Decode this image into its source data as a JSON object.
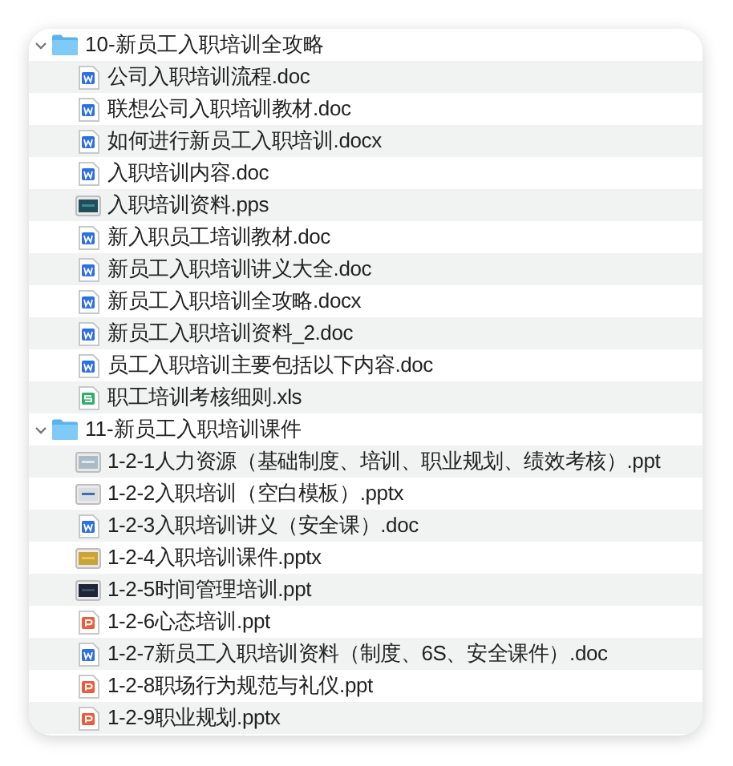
{
  "folders": [
    {
      "name": "10-新员工入职培训全攻略",
      "expanded": true,
      "files": [
        {
          "name": "公司入职培训流程.doc",
          "kind": "word"
        },
        {
          "name": "联想公司入职培训教材.doc",
          "kind": "word"
        },
        {
          "name": "如何进行新员工入职培训.docx",
          "kind": "word"
        },
        {
          "name": "入职培训内容.doc",
          "kind": "word"
        },
        {
          "name": "入职培训资料.pps",
          "kind": "preview-teal"
        },
        {
          "name": "新入职员工培训教材.doc",
          "kind": "word"
        },
        {
          "name": "新员工入职培训讲义大全.doc",
          "kind": "word"
        },
        {
          "name": "新员工入职培训全攻略.docx",
          "kind": "word"
        },
        {
          "name": "新员工入职培训资料_2.doc",
          "kind": "word"
        },
        {
          "name": "员工入职培训主要包括以下内容.doc",
          "kind": "word"
        },
        {
          "name": "职工培训考核细则.xls",
          "kind": "sheet"
        }
      ]
    },
    {
      "name": "11-新员工入职培训课件",
      "expanded": true,
      "files": [
        {
          "name": "1-2-1人力资源（基础制度、培训、职业规划、绩效考核）.ppt",
          "kind": "preview-grey"
        },
        {
          "name": "1-2-2入职培训（空白模板）.pptx",
          "kind": "preview-blue"
        },
        {
          "name": "1-2-3入职培训讲义（安全课）.doc",
          "kind": "word"
        },
        {
          "name": "1-2-4入职培训课件.pptx",
          "kind": "preview-gold"
        },
        {
          "name": "1-2-5时间管理培训.ppt",
          "kind": "preview-navy"
        },
        {
          "name": "1-2-6心态培训.ppt",
          "kind": "presentation"
        },
        {
          "name": "1-2-7新员工入职培训资料（制度、6S、安全课件）.doc",
          "kind": "word"
        },
        {
          "name": "1-2-8职场行为规范与礼仪.ppt",
          "kind": "presentation"
        },
        {
          "name": "1-2-9职业规划.pptx",
          "kind": "presentation"
        }
      ]
    }
  ]
}
